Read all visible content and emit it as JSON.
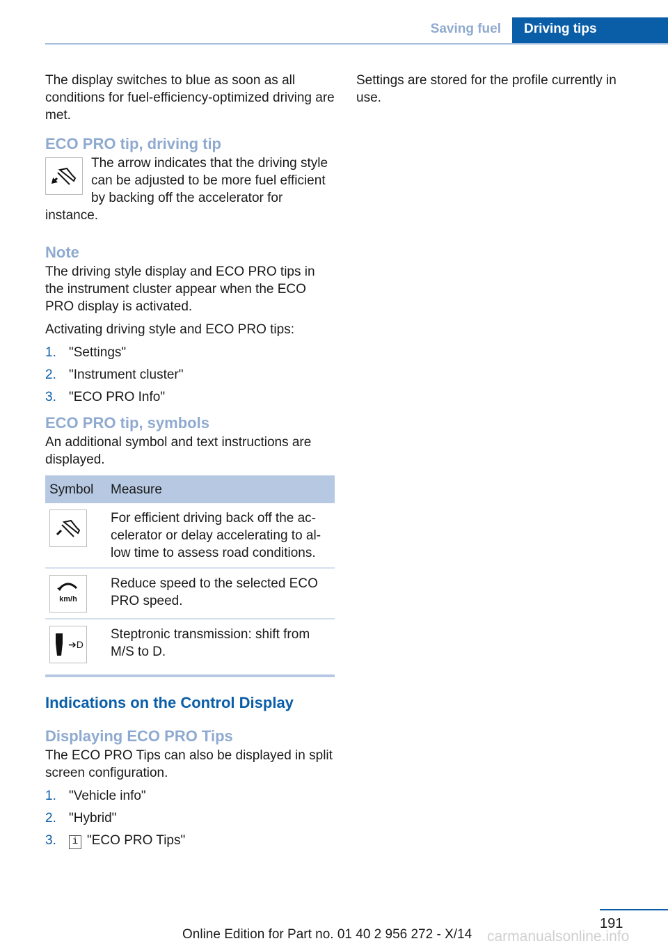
{
  "header": {
    "section": "Saving fuel",
    "active_tab": "Driving tips"
  },
  "left": {
    "intro": "The display switches to blue as soon as all conditions for fuel-efficiency-optimized driving are met.",
    "tip_heading": "ECO PRO tip, driving tip",
    "tip_icon": "accelerator-backoff-icon",
    "tip_text": "The arrow indicates that the driving style can be adjusted to be more fuel efficient by backing off the accelerator for instance.",
    "note_heading": "Note",
    "note_text": "The driving style display and ECO PRO tips in the instrument cluster appear when the ECO PRO display is activated.",
    "activate_text": "Activating driving style and ECO PRO tips:",
    "activate_steps": [
      {
        "num": "1.",
        "text": "\"Settings\""
      },
      {
        "num": "2.",
        "text": "\"Instrument cluster\""
      },
      {
        "num": "3.",
        "text": "\"ECO PRO Info\""
      }
    ],
    "symbols_heading": "ECO PRO tip, symbols",
    "symbols_text": "An additional symbol and text instructions are displayed.",
    "table": {
      "headers": [
        "Symbol",
        "Measure"
      ],
      "rows": [
        {
          "icon": "accelerator-backoff-icon",
          "text": "For efficient driving back off the ac-celerator or delay accelerating to al-low time to assess road conditions."
        },
        {
          "icon": "reduce-speed-kmh-icon",
          "icon_label": "km/h",
          "text": "Reduce speed to the selected ECO PRO speed."
        },
        {
          "icon": "gear-shift-to-d-icon",
          "icon_label": "D",
          "text": "Steptronic transmission: shift from M/S to D."
        }
      ]
    },
    "control_heading": "Indications on the Control Display",
    "display_heading": "Displaying ECO PRO Tips",
    "display_text": "The ECO PRO Tips can also be displayed in split screen configuration.",
    "display_steps": [
      {
        "num": "1.",
        "text": "\"Vehicle info\""
      },
      {
        "num": "2.",
        "text": "\"Hybrid\""
      },
      {
        "num": "3.",
        "icon": "i",
        "text": "\"ECO PRO Tips\""
      }
    ]
  },
  "right": {
    "text": "Settings are stored for the profile currently in use."
  },
  "footer": {
    "page": "191",
    "edition": "Online Edition for Part no. 01 40 2 956 272 - X/14",
    "watermark": "carmanualsonline.info"
  }
}
